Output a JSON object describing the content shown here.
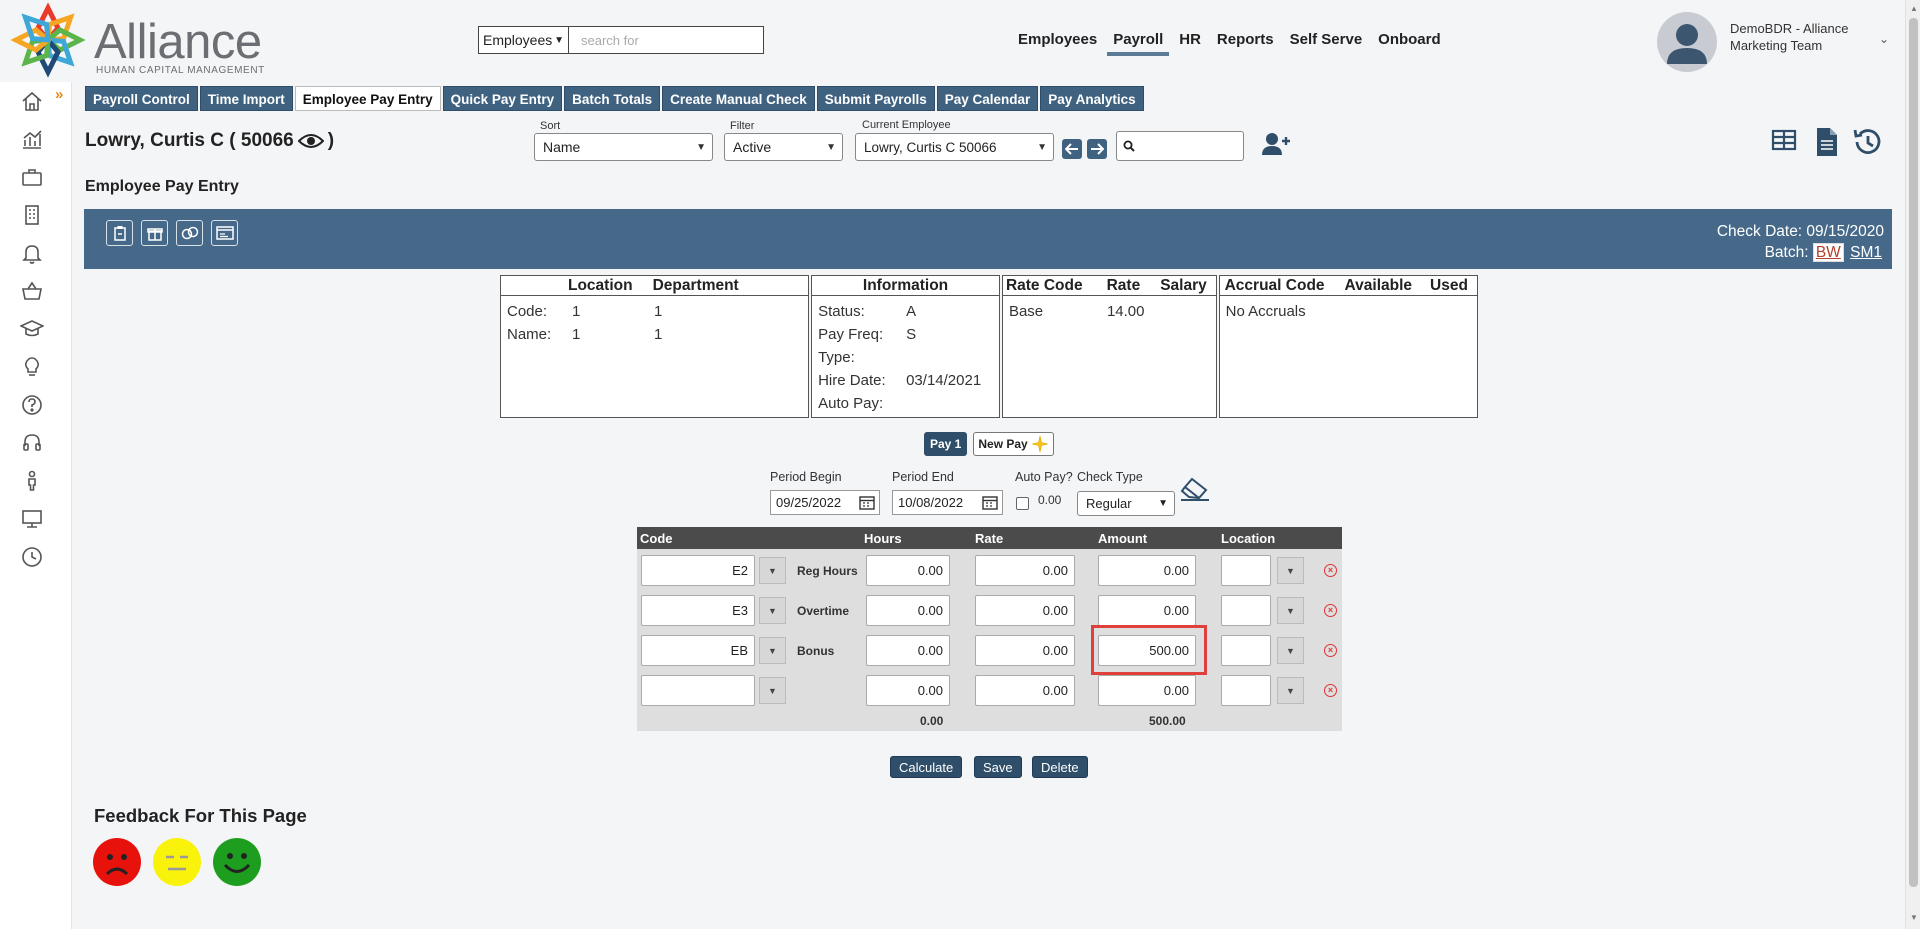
{
  "brand": {
    "name": "Alliance",
    "subtitle": "HUMAN CAPITAL MANAGEMENT",
    "colors": [
      "#e8392a",
      "#f5a623",
      "#3ea7d8",
      "#1f4a78",
      "#5bb54a"
    ]
  },
  "header": {
    "search_scope": "Employees",
    "search_placeholder": "search for",
    "nav": [
      "Employees",
      "Payroll",
      "HR",
      "Reports",
      "Self Serve",
      "Onboard"
    ],
    "active_nav": "Payroll",
    "user_name": "DemoBDR - Alliance Marketing Team"
  },
  "sidebar": {
    "icons": [
      "home-icon",
      "analytics-icon",
      "briefcase-icon",
      "building-icon",
      "bell-icon",
      "basket-icon",
      "graduation-cap-icon",
      "lightbulb-icon",
      "help-icon",
      "headset-icon",
      "person-icon",
      "monitor-icon",
      "clock-icon"
    ]
  },
  "tabs": [
    "Payroll Control",
    "Time Import",
    "Employee Pay Entry",
    "Quick Pay Entry",
    "Batch Totals",
    "Create Manual Check",
    "Submit Payrolls",
    "Pay Calendar",
    "Pay Analytics"
  ],
  "active_tab": "Employee Pay Entry",
  "employee": {
    "title": "Lowry, Curtis C ( 50066",
    "page_title": "Employee Pay Entry"
  },
  "controls": {
    "sort_label": "Sort",
    "sort_value": "Name",
    "filter_label": "Filter",
    "filter_value": "Active",
    "current_label": "Current Employee",
    "current_value": "Lowry, Curtis C 50066"
  },
  "bar": {
    "check_date": "Check Date: 09/15/2020",
    "batch_label": "Batch:",
    "batch_1": "BW",
    "batch_2": "SM1"
  },
  "info": {
    "location_hdr": "Location",
    "department_hdr": "Department",
    "code_label": "Code:",
    "code_loc": "1",
    "code_dept": "1",
    "name_label": "Name:",
    "name_loc": "1",
    "name_dept": "1",
    "information_hdr": "Information",
    "status_label": "Status:",
    "status_val": "A",
    "payfreq_label": "Pay Freq:",
    "payfreq_val": "S",
    "type_label": "Type:",
    "hire_label": "Hire Date:",
    "hire_val": "03/14/2021",
    "autopay_label": "Auto Pay:",
    "ratecode_hdr": "Rate Code",
    "rate_hdr": "Rate",
    "salary_hdr": "Salary",
    "rate_code": "Base",
    "rate_val": "14.00",
    "accrual_hdr": "Accrual Code",
    "available_hdr": "Available",
    "used_hdr": "Used",
    "accrual_val": "No Accruals"
  },
  "pay": {
    "pay1": "Pay 1",
    "new_pay": "New Pay",
    "period_begin_label": "Period Begin",
    "period_begin": "09/25/2022",
    "period_end_label": "Period End",
    "period_end": "10/08/2022",
    "autopay_label": "Auto Pay?",
    "autopay_val": "0.00",
    "check_type_label": "Check Type",
    "check_type": "Regular"
  },
  "grid": {
    "headers": [
      "Code",
      "Hours",
      "Rate",
      "Amount",
      "Location"
    ],
    "rows": [
      {
        "code": "E2",
        "desc": "Reg Hours",
        "hours": "0.00",
        "rate": "0.00",
        "amount": "0.00"
      },
      {
        "code": "E3",
        "desc": "Overtime",
        "hours": "0.00",
        "rate": "0.00",
        "amount": "0.00"
      },
      {
        "code": "EB",
        "desc": "Bonus",
        "hours": "0.00",
        "rate": "0.00",
        "amount": "500.00"
      },
      {
        "code": "",
        "desc": "",
        "hours": "0.00",
        "rate": "0.00",
        "amount": "0.00"
      }
    ],
    "total_hours": "0.00",
    "total_amount": "500.00"
  },
  "actions": {
    "calculate": "Calculate",
    "save": "Save",
    "delete": "Delete"
  },
  "feedback": {
    "title": "Feedback For This Page"
  }
}
